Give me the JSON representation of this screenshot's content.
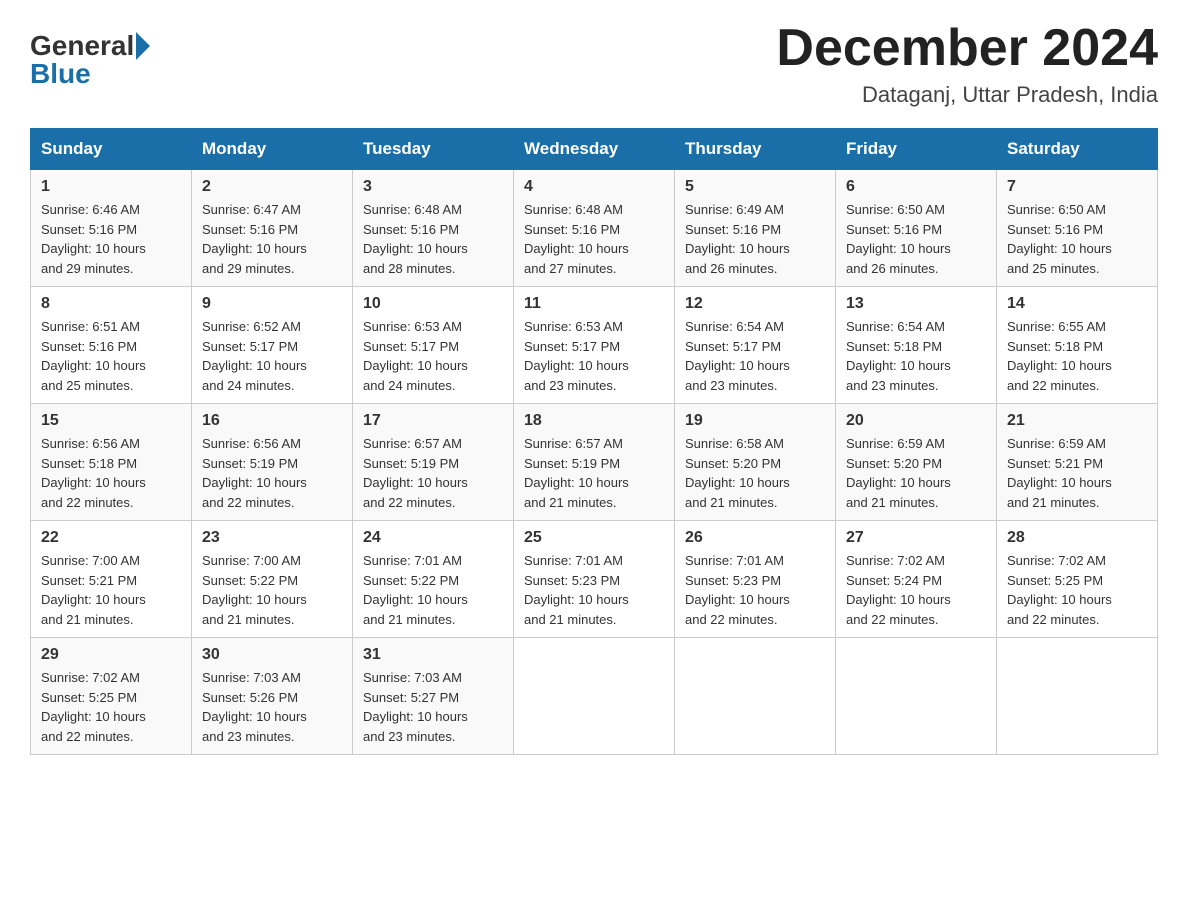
{
  "logo": {
    "general": "General",
    "blue": "Blue"
  },
  "title": {
    "month": "December 2024",
    "location": "Dataganj, Uttar Pradesh, India"
  },
  "headers": [
    "Sunday",
    "Monday",
    "Tuesday",
    "Wednesday",
    "Thursday",
    "Friday",
    "Saturday"
  ],
  "weeks": [
    [
      {
        "day": "1",
        "sunrise": "6:46 AM",
        "sunset": "5:16 PM",
        "daylight": "10 hours and 29 minutes."
      },
      {
        "day": "2",
        "sunrise": "6:47 AM",
        "sunset": "5:16 PM",
        "daylight": "10 hours and 29 minutes."
      },
      {
        "day": "3",
        "sunrise": "6:48 AM",
        "sunset": "5:16 PM",
        "daylight": "10 hours and 28 minutes."
      },
      {
        "day": "4",
        "sunrise": "6:48 AM",
        "sunset": "5:16 PM",
        "daylight": "10 hours and 27 minutes."
      },
      {
        "day": "5",
        "sunrise": "6:49 AM",
        "sunset": "5:16 PM",
        "daylight": "10 hours and 26 minutes."
      },
      {
        "day": "6",
        "sunrise": "6:50 AM",
        "sunset": "5:16 PM",
        "daylight": "10 hours and 26 minutes."
      },
      {
        "day": "7",
        "sunrise": "6:50 AM",
        "sunset": "5:16 PM",
        "daylight": "10 hours and 25 minutes."
      }
    ],
    [
      {
        "day": "8",
        "sunrise": "6:51 AM",
        "sunset": "5:16 PM",
        "daylight": "10 hours and 25 minutes."
      },
      {
        "day": "9",
        "sunrise": "6:52 AM",
        "sunset": "5:17 PM",
        "daylight": "10 hours and 24 minutes."
      },
      {
        "day": "10",
        "sunrise": "6:53 AM",
        "sunset": "5:17 PM",
        "daylight": "10 hours and 24 minutes."
      },
      {
        "day": "11",
        "sunrise": "6:53 AM",
        "sunset": "5:17 PM",
        "daylight": "10 hours and 23 minutes."
      },
      {
        "day": "12",
        "sunrise": "6:54 AM",
        "sunset": "5:17 PM",
        "daylight": "10 hours and 23 minutes."
      },
      {
        "day": "13",
        "sunrise": "6:54 AM",
        "sunset": "5:18 PM",
        "daylight": "10 hours and 23 minutes."
      },
      {
        "day": "14",
        "sunrise": "6:55 AM",
        "sunset": "5:18 PM",
        "daylight": "10 hours and 22 minutes."
      }
    ],
    [
      {
        "day": "15",
        "sunrise": "6:56 AM",
        "sunset": "5:18 PM",
        "daylight": "10 hours and 22 minutes."
      },
      {
        "day": "16",
        "sunrise": "6:56 AM",
        "sunset": "5:19 PM",
        "daylight": "10 hours and 22 minutes."
      },
      {
        "day": "17",
        "sunrise": "6:57 AM",
        "sunset": "5:19 PM",
        "daylight": "10 hours and 22 minutes."
      },
      {
        "day": "18",
        "sunrise": "6:57 AM",
        "sunset": "5:19 PM",
        "daylight": "10 hours and 21 minutes."
      },
      {
        "day": "19",
        "sunrise": "6:58 AM",
        "sunset": "5:20 PM",
        "daylight": "10 hours and 21 minutes."
      },
      {
        "day": "20",
        "sunrise": "6:59 AM",
        "sunset": "5:20 PM",
        "daylight": "10 hours and 21 minutes."
      },
      {
        "day": "21",
        "sunrise": "6:59 AM",
        "sunset": "5:21 PM",
        "daylight": "10 hours and 21 minutes."
      }
    ],
    [
      {
        "day": "22",
        "sunrise": "7:00 AM",
        "sunset": "5:21 PM",
        "daylight": "10 hours and 21 minutes."
      },
      {
        "day": "23",
        "sunrise": "7:00 AM",
        "sunset": "5:22 PM",
        "daylight": "10 hours and 21 minutes."
      },
      {
        "day": "24",
        "sunrise": "7:01 AM",
        "sunset": "5:22 PM",
        "daylight": "10 hours and 21 minutes."
      },
      {
        "day": "25",
        "sunrise": "7:01 AM",
        "sunset": "5:23 PM",
        "daylight": "10 hours and 21 minutes."
      },
      {
        "day": "26",
        "sunrise": "7:01 AM",
        "sunset": "5:23 PM",
        "daylight": "10 hours and 22 minutes."
      },
      {
        "day": "27",
        "sunrise": "7:02 AM",
        "sunset": "5:24 PM",
        "daylight": "10 hours and 22 minutes."
      },
      {
        "day": "28",
        "sunrise": "7:02 AM",
        "sunset": "5:25 PM",
        "daylight": "10 hours and 22 minutes."
      }
    ],
    [
      {
        "day": "29",
        "sunrise": "7:02 AM",
        "sunset": "5:25 PM",
        "daylight": "10 hours and 22 minutes."
      },
      {
        "day": "30",
        "sunrise": "7:03 AM",
        "sunset": "5:26 PM",
        "daylight": "10 hours and 23 minutes."
      },
      {
        "day": "31",
        "sunrise": "7:03 AM",
        "sunset": "5:27 PM",
        "daylight": "10 hours and 23 minutes."
      },
      null,
      null,
      null,
      null
    ]
  ],
  "labels": {
    "sunrise": "Sunrise:",
    "sunset": "Sunset:",
    "daylight": "Daylight:"
  },
  "colors": {
    "header_bg": "#1a6fa8",
    "accent": "#1a6fa8"
  }
}
